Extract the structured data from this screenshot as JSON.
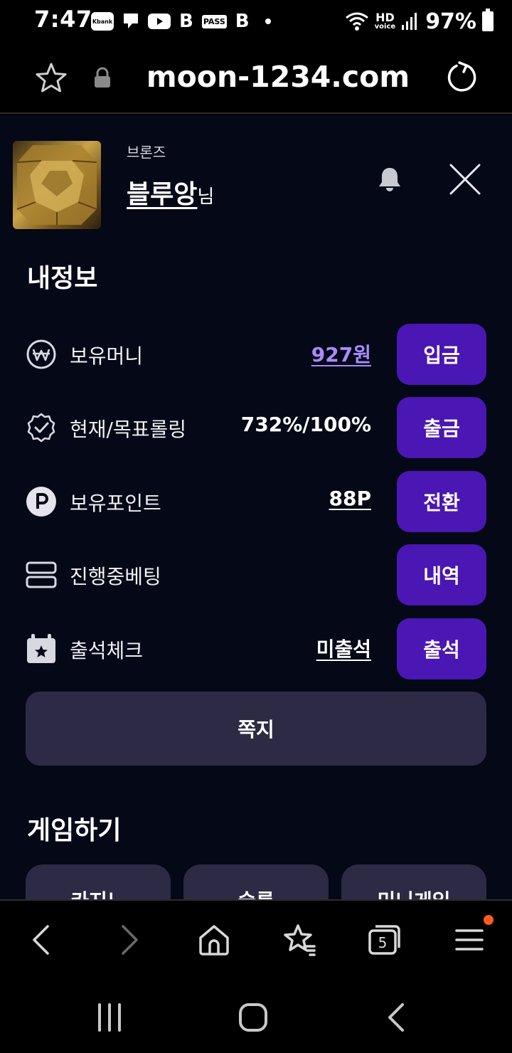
{
  "status_bar": {
    "time": "7:47",
    "app_icons": [
      "Kbank",
      "chat-bubble",
      "youtube",
      "B",
      "PASS",
      "B"
    ],
    "network": "HD",
    "network_sub": "voice",
    "battery": "97%"
  },
  "browser": {
    "url": "moon-1234.com",
    "tab_count": "5"
  },
  "profile": {
    "rank": "브론즈",
    "username": "블루앙",
    "suffix": "님"
  },
  "my_info": {
    "title": "내정보",
    "rows": [
      {
        "label": "보유머니",
        "value": "927원",
        "button": "입금",
        "icon": "won-icon"
      },
      {
        "label": "현재/목표롤링",
        "value": "732%/100%",
        "button": "출금",
        "icon": "verified-badge-icon"
      },
      {
        "label": "보유포인트",
        "value": "88P",
        "button": "전환",
        "icon": "point-icon"
      },
      {
        "label": "진행중베팅",
        "value": "",
        "button": "내역",
        "icon": "list-icon"
      },
      {
        "label": "출석체크",
        "value": "미출석",
        "button": "출석",
        "icon": "calendar-star-icon"
      }
    ],
    "message_button": "쪽지"
  },
  "games": {
    "title": "게임하기",
    "cards": [
      "카지노",
      "슬롯",
      "미니게임"
    ]
  },
  "colors": {
    "page_bg": "#050816",
    "button_purple": "#4a16b4",
    "card_bg": "#2c2a44",
    "money_link": "#a88bff",
    "notification_dot": "#ff5a1f"
  }
}
